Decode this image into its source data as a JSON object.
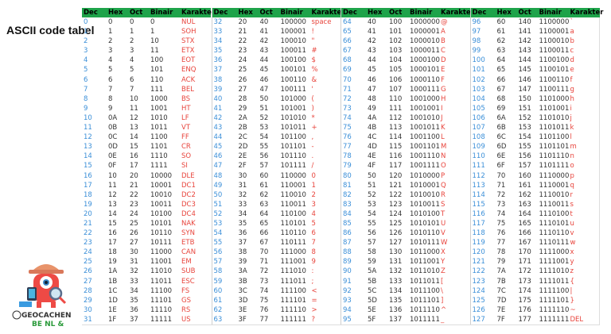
{
  "title": "ASCII code tabel",
  "colors": {
    "header": "#1ea34a",
    "dec": "#3b8fd8",
    "char": "#e8443c"
  },
  "columns": [
    "Dec",
    "Hex",
    "Oct",
    "Binair",
    "Karakter"
  ],
  "logo": {
    "text": "GEOCACHEN",
    "suffix": "BE NL &"
  },
  "groups": [
    {
      "rows": [
        [
          "0",
          "0",
          "0",
          "0",
          "NUL"
        ],
        [
          "1",
          "1",
          "1",
          "1",
          "SOH"
        ],
        [
          "2",
          "2",
          "2",
          "10",
          "STX"
        ],
        [
          "3",
          "3",
          "3",
          "11",
          "ETX"
        ],
        [
          "4",
          "4",
          "4",
          "100",
          "EOT"
        ],
        [
          "5",
          "5",
          "5",
          "101",
          "ENQ"
        ],
        [
          "6",
          "6",
          "6",
          "110",
          "ACK"
        ],
        [
          "7",
          "7",
          "7",
          "111",
          "BEL"
        ],
        [
          "8",
          "8",
          "10",
          "1000",
          "BS"
        ],
        [
          "9",
          "9",
          "11",
          "1001",
          "HT"
        ],
        [
          "10",
          "0A",
          "12",
          "1010",
          "LF"
        ],
        [
          "11",
          "0B",
          "13",
          "1011",
          "VT"
        ],
        [
          "12",
          "0C",
          "14",
          "1100",
          "FF"
        ],
        [
          "13",
          "0D",
          "15",
          "1101",
          "CR"
        ],
        [
          "14",
          "0E",
          "16",
          "1110",
          "SO"
        ],
        [
          "15",
          "0F",
          "17",
          "1111",
          "SI"
        ],
        [
          "16",
          "10",
          "20",
          "10000",
          "DLE"
        ],
        [
          "17",
          "11",
          "21",
          "10001",
          "DC1"
        ],
        [
          "18",
          "12",
          "22",
          "10010",
          "DC2"
        ],
        [
          "19",
          "13",
          "23",
          "10011",
          "DC3"
        ],
        [
          "20",
          "14",
          "24",
          "10100",
          "DC4"
        ],
        [
          "21",
          "15",
          "25",
          "10101",
          "NAK"
        ],
        [
          "22",
          "16",
          "26",
          "10110",
          "SYN"
        ],
        [
          "23",
          "17",
          "27",
          "10111",
          "ETB"
        ],
        [
          "24",
          "18",
          "30",
          "11000",
          "CAN"
        ],
        [
          "25",
          "19",
          "31",
          "11001",
          "EM"
        ],
        [
          "26",
          "1A",
          "32",
          "11010",
          "SUB"
        ],
        [
          "27",
          "1B",
          "33",
          "11011",
          "ESC"
        ],
        [
          "28",
          "1C",
          "34",
          "11100",
          "FS"
        ],
        [
          "29",
          "1D",
          "35",
          "11101",
          "GS"
        ],
        [
          "30",
          "1E",
          "36",
          "11110",
          "RS"
        ],
        [
          "31",
          "1F",
          "37",
          "11111",
          "US"
        ]
      ]
    },
    {
      "rows": [
        [
          "32",
          "20",
          "40",
          "100000",
          "space"
        ],
        [
          "33",
          "21",
          "41",
          "100001",
          "!"
        ],
        [
          "34",
          "22",
          "42",
          "100010",
          "\""
        ],
        [
          "35",
          "23",
          "43",
          "100011",
          "#"
        ],
        [
          "36",
          "24",
          "44",
          "100100",
          "$"
        ],
        [
          "37",
          "25",
          "45",
          "100101",
          "%"
        ],
        [
          "38",
          "26",
          "46",
          "100110",
          "&"
        ],
        [
          "39",
          "27",
          "47",
          "100111",
          "'"
        ],
        [
          "40",
          "28",
          "50",
          "101000",
          "("
        ],
        [
          "41",
          "29",
          "51",
          "101001",
          ")"
        ],
        [
          "42",
          "2A",
          "52",
          "101010",
          "*"
        ],
        [
          "43",
          "2B",
          "53",
          "101011",
          "+"
        ],
        [
          "44",
          "2C",
          "54",
          "101100",
          ","
        ],
        [
          "45",
          "2D",
          "55",
          "101101",
          "-"
        ],
        [
          "46",
          "2E",
          "56",
          "101110",
          "."
        ],
        [
          "47",
          "2F",
          "57",
          "101111",
          "/"
        ],
        [
          "48",
          "30",
          "60",
          "110000",
          "0"
        ],
        [
          "49",
          "31",
          "61",
          "110001",
          "1"
        ],
        [
          "50",
          "32",
          "62",
          "110010",
          "2"
        ],
        [
          "51",
          "33",
          "63",
          "110011",
          "3"
        ],
        [
          "52",
          "34",
          "64",
          "110100",
          "4"
        ],
        [
          "53",
          "35",
          "65",
          "110101",
          "5"
        ],
        [
          "54",
          "36",
          "66",
          "110110",
          "6"
        ],
        [
          "55",
          "37",
          "67",
          "110111",
          "7"
        ],
        [
          "56",
          "38",
          "70",
          "111000",
          "8"
        ],
        [
          "57",
          "39",
          "71",
          "111001",
          "9"
        ],
        [
          "58",
          "3A",
          "72",
          "111010",
          ":"
        ],
        [
          "59",
          "3B",
          "73",
          "111011",
          ";"
        ],
        [
          "60",
          "3C",
          "74",
          "111100",
          "<"
        ],
        [
          "61",
          "3D",
          "75",
          "111101",
          "="
        ],
        [
          "62",
          "3E",
          "76",
          "111110",
          ">"
        ],
        [
          "63",
          "3F",
          "77",
          "111111",
          "?"
        ]
      ]
    },
    {
      "rows": [
        [
          "64",
          "40",
          "100",
          "1000000",
          "@"
        ],
        [
          "65",
          "41",
          "101",
          "1000001",
          "A"
        ],
        [
          "66",
          "42",
          "102",
          "1000010",
          "B"
        ],
        [
          "67",
          "43",
          "103",
          "1000011",
          "C"
        ],
        [
          "68",
          "44",
          "104",
          "1000100",
          "D"
        ],
        [
          "69",
          "45",
          "105",
          "1000101",
          "E"
        ],
        [
          "70",
          "46",
          "106",
          "1000110",
          "F"
        ],
        [
          "71",
          "47",
          "107",
          "1000111",
          "G"
        ],
        [
          "72",
          "48",
          "110",
          "1001000",
          "H"
        ],
        [
          "73",
          "49",
          "111",
          "1001001",
          "I"
        ],
        [
          "74",
          "4A",
          "112",
          "1001010",
          "J"
        ],
        [
          "75",
          "4B",
          "113",
          "1001011",
          "K"
        ],
        [
          "76",
          "4C",
          "114",
          "1001100",
          "L"
        ],
        [
          "77",
          "4D",
          "115",
          "1001101",
          "M"
        ],
        [
          "78",
          "4E",
          "116",
          "1001110",
          "N"
        ],
        [
          "79",
          "4F",
          "117",
          "1001111",
          "O"
        ],
        [
          "80",
          "50",
          "120",
          "1010000",
          "P"
        ],
        [
          "81",
          "51",
          "121",
          "1010001",
          "Q"
        ],
        [
          "82",
          "52",
          "122",
          "1010010",
          "R"
        ],
        [
          "83",
          "53",
          "123",
          "1010011",
          "S"
        ],
        [
          "84",
          "54",
          "124",
          "1010100",
          "T"
        ],
        [
          "85",
          "55",
          "125",
          "1010101",
          "U"
        ],
        [
          "86",
          "56",
          "126",
          "1010110",
          "V"
        ],
        [
          "87",
          "57",
          "127",
          "1010111",
          "W"
        ],
        [
          "88",
          "58",
          "130",
          "1011000",
          "X"
        ],
        [
          "89",
          "59",
          "131",
          "1011001",
          "Y"
        ],
        [
          "90",
          "5A",
          "132",
          "1011010",
          "Z"
        ],
        [
          "91",
          "5B",
          "133",
          "1011011",
          "["
        ],
        [
          "92",
          "5C",
          "134",
          "1011100",
          "\\"
        ],
        [
          "93",
          "5D",
          "135",
          "1011101",
          "]"
        ],
        [
          "94",
          "5E",
          "136",
          "1011110",
          "^"
        ],
        [
          "95",
          "5F",
          "137",
          "1011111",
          "_"
        ]
      ]
    },
    {
      "rows": [
        [
          "96",
          "60",
          "140",
          "1100000",
          "`"
        ],
        [
          "97",
          "61",
          "141",
          "1100001",
          "a"
        ],
        [
          "98",
          "62",
          "142",
          "1100010",
          "b"
        ],
        [
          "99",
          "63",
          "143",
          "1100011",
          "c"
        ],
        [
          "100",
          "64",
          "144",
          "1100100",
          "d"
        ],
        [
          "101",
          "65",
          "145",
          "1100101",
          "e"
        ],
        [
          "102",
          "66",
          "146",
          "1100110",
          "f"
        ],
        [
          "103",
          "67",
          "147",
          "1100111",
          "g"
        ],
        [
          "104",
          "68",
          "150",
          "1101000",
          "h"
        ],
        [
          "105",
          "69",
          "151",
          "1101001",
          "i"
        ],
        [
          "106",
          "6A",
          "152",
          "1101010",
          "j"
        ],
        [
          "107",
          "6B",
          "153",
          "1101011",
          "k"
        ],
        [
          "108",
          "6C",
          "154",
          "1101100",
          "l"
        ],
        [
          "109",
          "6D",
          "155",
          "1101101",
          "m"
        ],
        [
          "110",
          "6E",
          "156",
          "1101110",
          "n"
        ],
        [
          "111",
          "6F",
          "157",
          "1101111",
          "o"
        ],
        [
          "112",
          "70",
          "160",
          "1110000",
          "p"
        ],
        [
          "113",
          "71",
          "161",
          "1110001",
          "q"
        ],
        [
          "114",
          "72",
          "162",
          "1110010",
          "r"
        ],
        [
          "115",
          "73",
          "163",
          "1110011",
          "s"
        ],
        [
          "116",
          "74",
          "164",
          "1110100",
          "t"
        ],
        [
          "117",
          "75",
          "165",
          "1110101",
          "u"
        ],
        [
          "118",
          "76",
          "166",
          "1110110",
          "v"
        ],
        [
          "119",
          "77",
          "167",
          "1110111",
          "w"
        ],
        [
          "120",
          "78",
          "170",
          "1111000",
          "x"
        ],
        [
          "121",
          "79",
          "171",
          "1111001",
          "y"
        ],
        [
          "122",
          "7A",
          "172",
          "1111010",
          "z"
        ],
        [
          "123",
          "7B",
          "173",
          "1111011",
          "{"
        ],
        [
          "124",
          "7C",
          "174",
          "1111100",
          "|"
        ],
        [
          "125",
          "7D",
          "175",
          "1111101",
          "}"
        ],
        [
          "126",
          "7E",
          "176",
          "1111110",
          "~"
        ],
        [
          "127",
          "7F",
          "177",
          "1111111",
          "DEL"
        ]
      ]
    }
  ]
}
